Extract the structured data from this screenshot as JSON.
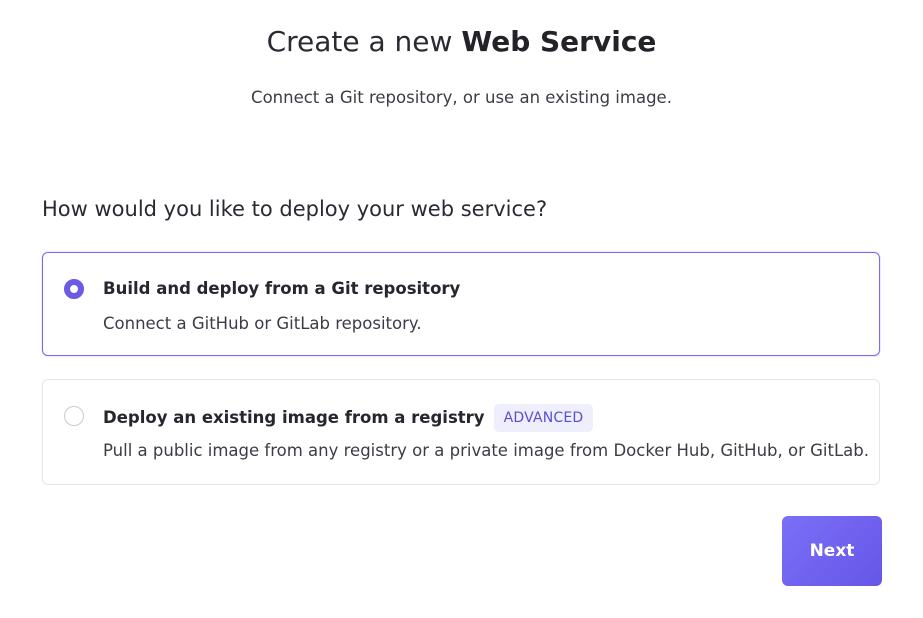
{
  "header": {
    "title_prefix": "Create a new ",
    "title_strong": "Web Service",
    "subtitle": "Connect a Git repository, or use an existing image."
  },
  "question": "How would you like to deploy your web service?",
  "options": [
    {
      "title": "Build and deploy from a Git repository",
      "description": "Connect a GitHub or GitLab repository.",
      "selected": true
    },
    {
      "title": "Deploy an existing image from a registry",
      "badge": "ADVANCED",
      "description": "Pull a public image from any registry or a private image from Docker Hub, GitHub, or GitLab.",
      "selected": false
    }
  ],
  "actions": {
    "next_label": "Next"
  },
  "colors": {
    "accent": "#6a5ae6",
    "selected_border": "#7a6cf0",
    "badge_bg": "#efeefc",
    "badge_text": "#5a4fd1"
  }
}
